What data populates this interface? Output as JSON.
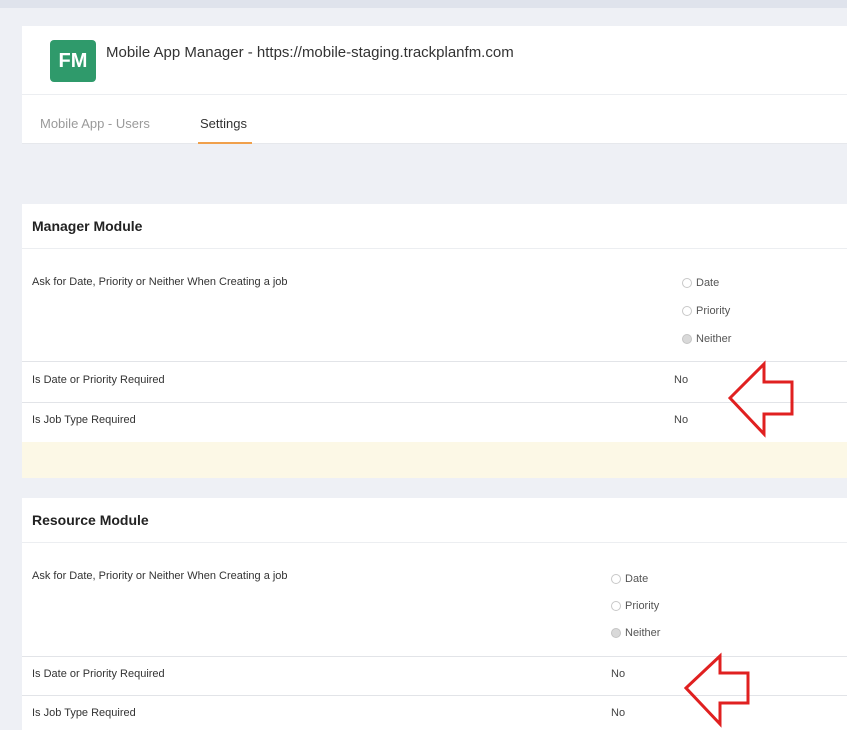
{
  "header": {
    "logo_text": "FM",
    "title": "Mobile App Manager - https://mobile-staging.trackplanfm.com",
    "tabs": [
      {
        "label": "Mobile App - Users",
        "active": false
      },
      {
        "label": "Settings",
        "active": true
      }
    ]
  },
  "manager": {
    "title": "Manager Module",
    "ask_label": "Ask for Date, Priority or Neither When Creating a job",
    "options": [
      "Date",
      "Priority",
      "Neither"
    ],
    "selected": "Neither",
    "date_priority_required_label": "Is Date or Priority Required",
    "date_priority_required_value": "No",
    "job_type_required_label": "Is Job Type Required",
    "job_type_required_value": "No"
  },
  "resource": {
    "title": "Resource Module",
    "ask_label": "Ask for Date, Priority or Neither When Creating a job",
    "options": [
      "Date",
      "Priority",
      "Neither"
    ],
    "selected": "Neither",
    "date_priority_required_label": "Is Date or Priority Required",
    "date_priority_required_value": "No",
    "job_type_required_label": "Is Job Type Required",
    "job_type_required_value": "No"
  },
  "colors": {
    "logo_bg": "#2f9a6b",
    "tab_underline": "#f0a04b",
    "annotation_arrow": "#e02020",
    "notice_band": "#fcf8e6"
  }
}
